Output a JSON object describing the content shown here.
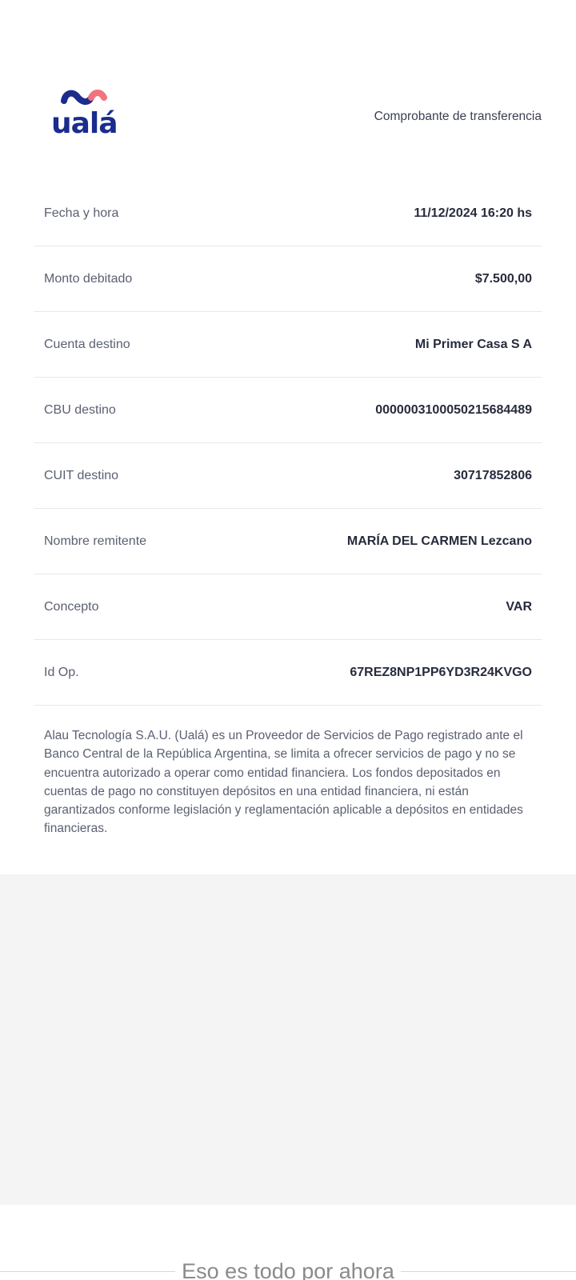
{
  "brand": {
    "name": "ualá",
    "colors": {
      "primary": "#1a2c8c",
      "accent": "#f2737e"
    }
  },
  "header": {
    "document_type": "Comprobante de transferencia"
  },
  "details": [
    {
      "label": "Fecha y hora",
      "value": "11/12/2024 16:20 hs"
    },
    {
      "label": "Monto debitado",
      "value": "$7.500,00"
    },
    {
      "label": "Cuenta destino",
      "value": "Mi Primer Casa S A"
    },
    {
      "label": "CBU destino",
      "value": "0000003100050215684489"
    },
    {
      "label": "CUIT destino",
      "value": "30717852806"
    },
    {
      "label": "Nombre remitente",
      "value": "MARÍA DEL CARMEN Lezcano"
    },
    {
      "label": "Concepto",
      "value": "VAR"
    },
    {
      "label": "Id Op.",
      "value": "67REZ8NP1PP6YD3R24KVGO"
    }
  ],
  "legal_text": "Alau Tecnología S.A.U. (Ualá) es un Proveedor de Servicios de Pago registrado ante el Banco Central de la República Argentina, se limita a ofrecer servicios de pago y no se encuentra autorizado a operar como entidad financiera. Los fondos depositados en cuentas de pago no constituyen depósitos en una entidad financiera, ni están garantizados conforme legislación y reglamentación aplicable a depósitos en entidades financieras.",
  "footer": {
    "end_message": "Eso es todo por ahora"
  }
}
